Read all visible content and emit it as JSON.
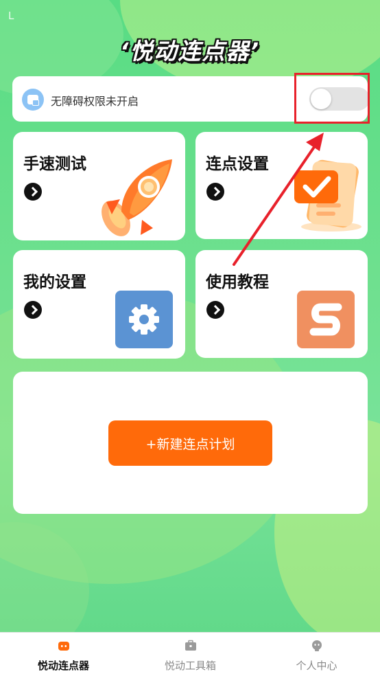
{
  "status_bar": {
    "mark": "L"
  },
  "app": {
    "title": "‘悦动连点器’"
  },
  "permission": {
    "text": "无障碍权限未开启",
    "icon": "accessibility-window-icon",
    "toggle_on": false
  },
  "tiles": [
    {
      "label": "手速测试",
      "icon": "rocket-icon",
      "arrow_icon": "chevron-right-icon"
    },
    {
      "label": "连点设置",
      "icon": "checklist-document-icon",
      "arrow_icon": "chevron-right-icon"
    },
    {
      "label": "我的设置",
      "icon": "gear-icon",
      "arrow_icon": "chevron-right-icon"
    },
    {
      "label": "使用教程",
      "icon": "tutorial-s-icon",
      "arrow_icon": "chevron-right-icon"
    }
  ],
  "plan": {
    "button_label": "+新建连点计划"
  },
  "tabbar": {
    "items": [
      {
        "label": "悦动连点器",
        "icon": "home-robot-icon",
        "active": true
      },
      {
        "label": "悦动工具箱",
        "icon": "toolbox-icon",
        "active": false
      },
      {
        "label": "个人中心",
        "icon": "profile-icon",
        "active": false
      }
    ]
  },
  "colors": {
    "accent_orange": "#ff6a0a",
    "background_green": "#5fd98a",
    "highlight_red": "#e8212b",
    "gear_tile_blue": "#5b93d3",
    "tutorial_tile_orange": "#f09060"
  }
}
